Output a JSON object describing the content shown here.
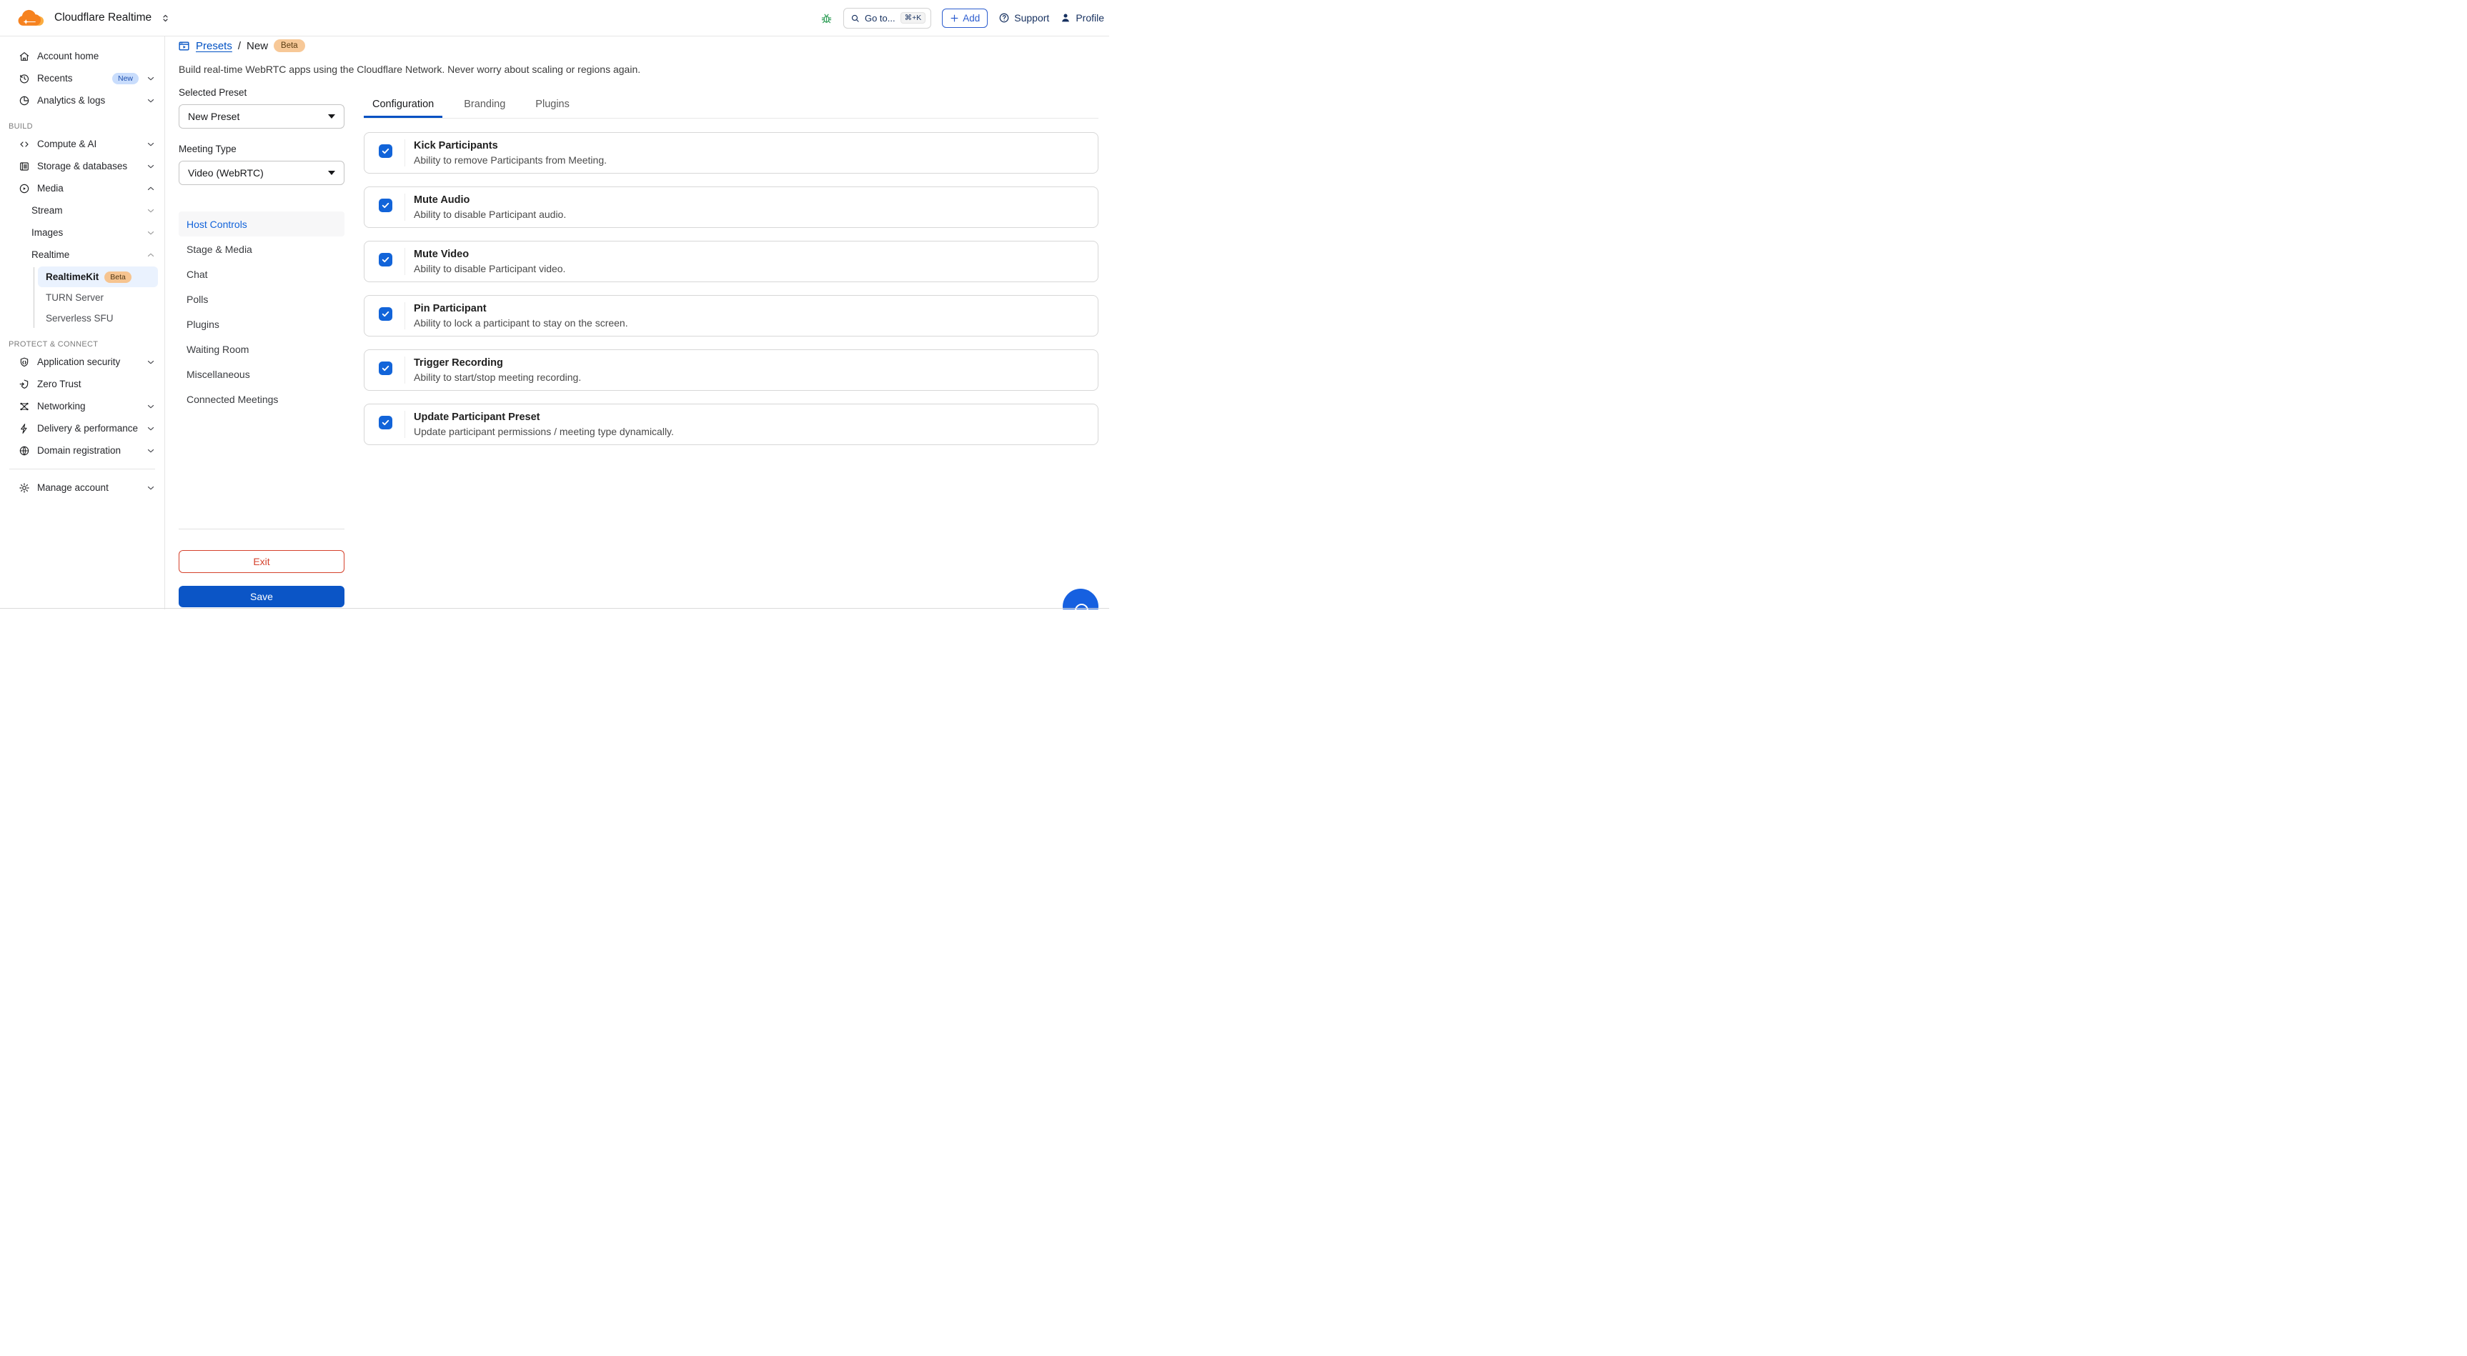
{
  "brand": {
    "app_title": "Cloudflare Realtime"
  },
  "header": {
    "search_placeholder": "Go to...",
    "search_shortcut": "⌘+K",
    "add_label": "Add",
    "support_label": "Support",
    "profile_label": "Profile"
  },
  "sidebar": {
    "top_items": [
      {
        "label": "Account home",
        "icon": "home-icon"
      },
      {
        "label": "Recents",
        "icon": "history-icon",
        "badge": "New"
      },
      {
        "label": "Analytics & logs",
        "icon": "pie-chart-icon"
      }
    ],
    "sections": [
      {
        "label": "BUILD"
      },
      {
        "label": "PROTECT & CONNECT"
      }
    ],
    "build_items": [
      {
        "label": "Compute & AI",
        "icon": "code-icon"
      },
      {
        "label": "Storage & databases",
        "icon": "storage-icon"
      },
      {
        "label": "Media",
        "icon": "play-circle-icon"
      }
    ],
    "media_children": [
      {
        "label": "Stream"
      },
      {
        "label": "Images"
      },
      {
        "label": "Realtime"
      }
    ],
    "realtime_children": [
      {
        "label": "RealtimeKit",
        "badge": "Beta"
      },
      {
        "label": "TURN Server"
      },
      {
        "label": "Serverless SFU"
      }
    ],
    "protect_items": [
      {
        "label": "Application security",
        "icon": "shield-code-icon"
      },
      {
        "label": "Zero Trust",
        "icon": "shield-arrow-icon"
      },
      {
        "label": "Networking",
        "icon": "network-icon"
      },
      {
        "label": "Delivery & performance",
        "icon": "lightning-icon"
      },
      {
        "label": "Domain registration",
        "icon": "globe-icon"
      }
    ],
    "footer_items": [
      {
        "label": "Manage account",
        "icon": "gear-icon"
      }
    ]
  },
  "breadcrumb": {
    "link": "Presets",
    "separator": "/",
    "current": "New",
    "badge": "Beta"
  },
  "page": {
    "description": "Build real-time WebRTC apps using the Cloudflare Network. Never worry about scaling or regions again."
  },
  "preset_panel": {
    "selected_preset_label": "Selected Preset",
    "selected_preset_value": "New Preset",
    "meeting_type_label": "Meeting Type",
    "meeting_type_value": "Video (WebRTC)",
    "menu": [
      {
        "label": "Host Controls",
        "active": true
      },
      {
        "label": "Stage & Media"
      },
      {
        "label": "Chat"
      },
      {
        "label": "Polls"
      },
      {
        "label": "Plugins"
      },
      {
        "label": "Waiting Room"
      },
      {
        "label": "Miscellaneous"
      },
      {
        "label": "Connected Meetings"
      }
    ],
    "exit_label": "Exit",
    "save_label": "Save"
  },
  "tabs": [
    {
      "label": "Configuration",
      "active": true
    },
    {
      "label": "Branding"
    },
    {
      "label": "Plugins"
    }
  ],
  "permissions": [
    {
      "title": "Kick Participants",
      "description": "Ability to remove Participants from Meeting.",
      "checked": true
    },
    {
      "title": "Mute Audio",
      "description": "Ability to disable Participant audio.",
      "checked": true
    },
    {
      "title": "Mute Video",
      "description": "Ability to disable Participant video.",
      "checked": true
    },
    {
      "title": "Pin Participant",
      "description": "Ability to lock a participant to stay on the screen.",
      "checked": true
    },
    {
      "title": "Trigger Recording",
      "description": "Ability to start/stop meeting recording.",
      "checked": true
    },
    {
      "title": "Update Participant Preset",
      "description": "Update participant permissions / meeting type dynamically.",
      "checked": true
    }
  ],
  "colors": {
    "accent_blue": "#0051c3",
    "checkbox_blue": "#1264d9",
    "danger_red": "#d5422c",
    "brand_orange": "#f6821f",
    "beta_badge_bg": "#f6c490",
    "new_badge_bg": "#c9ddfc",
    "active_item_bg": "#eaf2fe",
    "bug_green": "#2f9e57"
  }
}
